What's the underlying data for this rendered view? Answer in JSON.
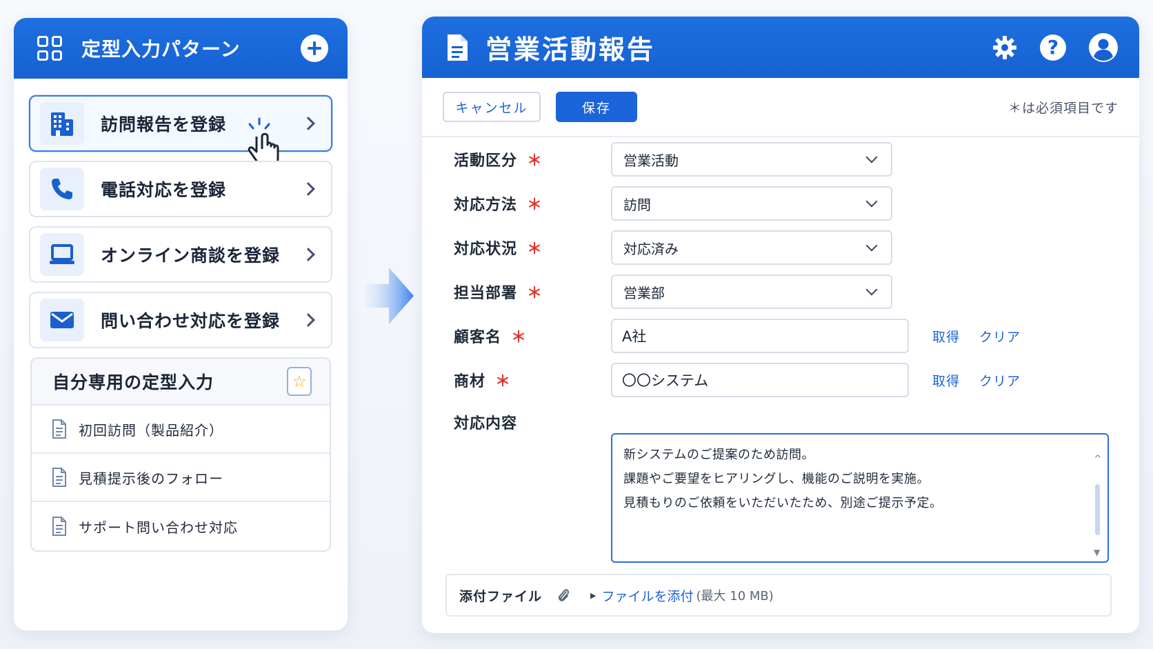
{
  "left_panel": {
    "title": "定型入力パターン",
    "quick_items": [
      {
        "label": "訪問報告を登録",
        "icon": "building-icon"
      },
      {
        "label": "電話対応を登録",
        "icon": "phone-icon"
      },
      {
        "label": "オンライン商談を登録",
        "icon": "laptop-icon"
      },
      {
        "label": "問い合わせ対応を登録",
        "icon": "mail-icon"
      }
    ],
    "custom": {
      "title": "自分専用の定型入力",
      "items": [
        "初回訪問（製品紹介）",
        "見積提示後のフォロー",
        "サポート問い合わせ対応"
      ]
    }
  },
  "form": {
    "title": "営業活動報告",
    "cancel_label": "キャンセル",
    "save_label": "保存",
    "required_note": "＊は必須項目です",
    "required_mark": "＊",
    "fields": {
      "activity_type": {
        "label": "活動区分",
        "value": "営業活動"
      },
      "method": {
        "label": "対応方法",
        "value": "訪問"
      },
      "status": {
        "label": "対応状況",
        "value": "対応済み"
      },
      "department": {
        "label": "担当部署",
        "value": "営業部"
      },
      "customer": {
        "label": "顧客名",
        "value": "A社"
      },
      "product": {
        "label": "商材",
        "value": "〇〇システム"
      },
      "content": {
        "label": "対応内容",
        "lines": [
          "新システムのご提案のため訪問。",
          "課題やご要望をヒアリングし、機能のご説明を実施。",
          "見積もりのご依頼をいただいたため、別途ご提示予定。"
        ]
      }
    },
    "fetch_label": "取得",
    "clear_label": "クリア",
    "attachment": {
      "label": "添付ファイル",
      "link": "ファイルを添付",
      "limit": "(最大 10 MB)"
    }
  },
  "colors": {
    "primary": "#1b64d9",
    "header": "#1561d2",
    "required": "#e5352b",
    "star": "#f0ad1a"
  }
}
